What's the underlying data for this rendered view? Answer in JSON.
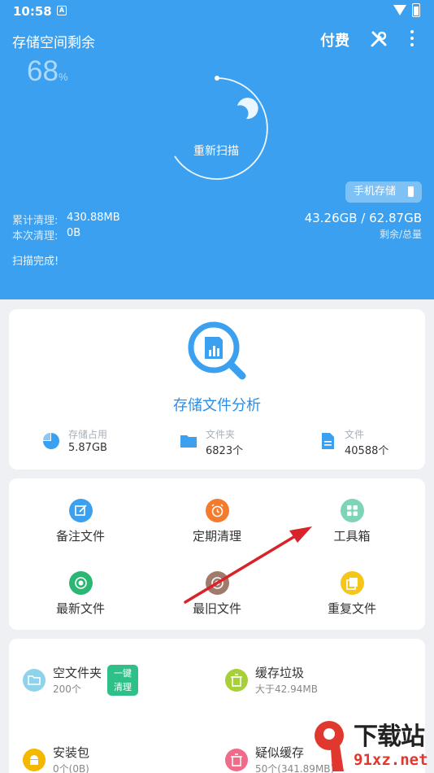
{
  "status_bar": {
    "time": "10:58",
    "notification_letter": "A"
  },
  "header": {
    "title": "存储空间剩余",
    "pay_label": "付费",
    "percent_value": "68",
    "percent_unit": "%",
    "rescan_label": "重新扫描",
    "phone_storage_label": "手机存储",
    "total_cleaned_label": "累计清理:",
    "total_cleaned_value": "430.88MB",
    "this_cleaned_label": "本次清理:",
    "this_cleaned_value": "0B",
    "storage_value": "43.26GB / 62.87GB",
    "storage_sub": "剩余/总量",
    "scan_status": "扫描完成!"
  },
  "analysis": {
    "title": "存储文件分析",
    "stats": [
      {
        "label": "存储占用",
        "value": "5.87GB",
        "icon": "pie-chart-icon"
      },
      {
        "label": "文件夹",
        "value": "6823个",
        "icon": "folder-icon"
      },
      {
        "label": "文件",
        "value": "40588个",
        "icon": "file-icon"
      }
    ]
  },
  "tools": {
    "items": [
      {
        "label": "备注文件",
        "icon": "edit-note-icon",
        "color": "#3aa0ef"
      },
      {
        "label": "定期清理",
        "icon": "alarm-clock-icon",
        "color": "#f57b2c"
      },
      {
        "label": "工具箱",
        "icon": "toolbox-grid-icon",
        "color": "#7ed4b6"
      },
      {
        "label": "最新文件",
        "icon": "new-file-icon",
        "color": "#2bb673"
      },
      {
        "label": "最旧文件",
        "icon": "old-file-icon",
        "color": "#a07a6a"
      },
      {
        "label": "重复文件",
        "icon": "duplicate-file-icon",
        "color": "#f5c518"
      }
    ]
  },
  "cleanup": {
    "clean_button_line1": "一键",
    "clean_button_line2": "清理",
    "items": [
      {
        "title": "空文件夹",
        "sub": "200个",
        "icon": "empty-folder-icon",
        "color": "#8fd3ea"
      },
      {
        "title": "缓存垃圾",
        "sub": "大于42.94MB",
        "icon": "trash-icon",
        "color": "#a6cf3a"
      },
      {
        "title": "安装包",
        "sub": "0个(0B)",
        "icon": "android-icon",
        "color": "#f5b800"
      },
      {
        "title": "疑似缓存",
        "sub": "50个(341.89MB)",
        "icon": "trash-suspect-icon",
        "color": "#f06a8a"
      }
    ]
  },
  "watermark": {
    "text": "下载站",
    "url": "91xz.net",
    "mark": "9"
  },
  "colors": {
    "hero": "#3aa0ef",
    "accent": "#2a8de6",
    "arrow": "#d8232a"
  }
}
